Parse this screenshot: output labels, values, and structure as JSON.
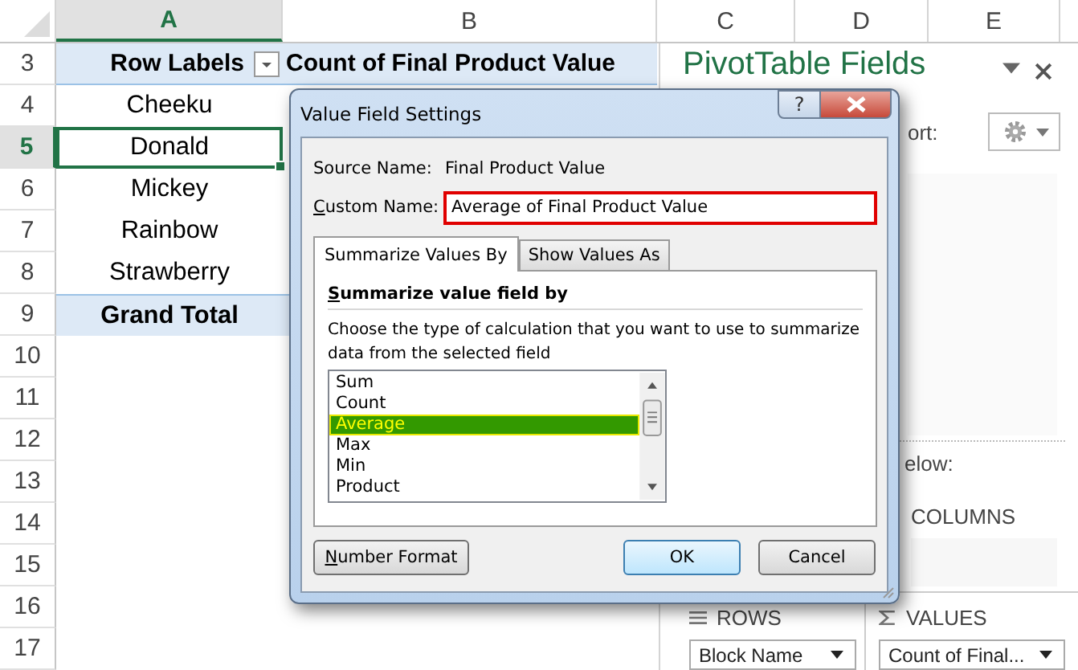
{
  "columns": [
    {
      "label": "A",
      "selected": true
    },
    {
      "label": "B",
      "selected": false
    },
    {
      "label": "C",
      "selected": false
    },
    {
      "label": "D",
      "selected": false
    },
    {
      "label": "E",
      "selected": false
    }
  ],
  "rows": [
    {
      "number": "3",
      "kind": "header",
      "selected": false,
      "cells": [
        "Row Labels",
        "Count of Final Product Value"
      ]
    },
    {
      "number": "4",
      "kind": "item",
      "selected": false,
      "cells": [
        "Cheeku"
      ]
    },
    {
      "number": "5",
      "kind": "item",
      "selected": true,
      "cells": [
        "Donald"
      ]
    },
    {
      "number": "6",
      "kind": "item",
      "selected": false,
      "cells": [
        "Mickey"
      ]
    },
    {
      "number": "7",
      "kind": "item",
      "selected": false,
      "cells": [
        "Rainbow"
      ]
    },
    {
      "number": "8",
      "kind": "item",
      "selected": false,
      "cells": [
        "Strawberry"
      ]
    },
    {
      "number": "9",
      "kind": "total",
      "selected": false,
      "cells": [
        "Grand Total"
      ]
    },
    {
      "number": "10",
      "kind": "empty",
      "selected": false,
      "cells": []
    },
    {
      "number": "11",
      "kind": "empty",
      "selected": false,
      "cells": []
    },
    {
      "number": "12",
      "kind": "empty",
      "selected": false,
      "cells": []
    },
    {
      "number": "13",
      "kind": "empty",
      "selected": false,
      "cells": []
    },
    {
      "number": "14",
      "kind": "empty",
      "selected": false,
      "cells": []
    },
    {
      "number": "15",
      "kind": "empty",
      "selected": false,
      "cells": []
    },
    {
      "number": "16",
      "kind": "empty",
      "selected": false,
      "cells": []
    },
    {
      "number": "17",
      "kind": "empty",
      "selected": false,
      "cells": []
    }
  ],
  "pivot_pane": {
    "title": "PivotTable Fields",
    "choose_label": "ort:",
    "areas_label": "elow:",
    "columns_area": "COLUMNS",
    "rows_area": {
      "label": "ROWS",
      "field": "Block Name"
    },
    "values_area": {
      "label": "VALUES",
      "field": "Count of Final..."
    }
  },
  "dialog": {
    "title": "Value Field Settings",
    "help_button": "?",
    "source_label": "Source Name:",
    "source_value": "Final Product Value",
    "custom_label": "Custom Name:",
    "custom_value": "Average of Final Product Value",
    "tabs": [
      {
        "label": "Summarize Values By",
        "selected": true
      },
      {
        "label": "Show Values As",
        "selected": false
      }
    ],
    "section_title": "Summarize value field by",
    "description": "Choose the type of calculation that you want to use to summarize data from the selected field",
    "functions": [
      {
        "label": "Sum",
        "selected": false
      },
      {
        "label": "Count",
        "selected": false
      },
      {
        "label": "Average",
        "selected": true
      },
      {
        "label": "Max",
        "selected": false
      },
      {
        "label": "Min",
        "selected": false
      },
      {
        "label": "Product",
        "selected": false
      }
    ],
    "buttons": [
      {
        "label": "Number Format",
        "kind": "secondary"
      },
      {
        "label": "OK",
        "kind": "default"
      },
      {
        "label": "Cancel",
        "kind": "secondary"
      }
    ]
  }
}
